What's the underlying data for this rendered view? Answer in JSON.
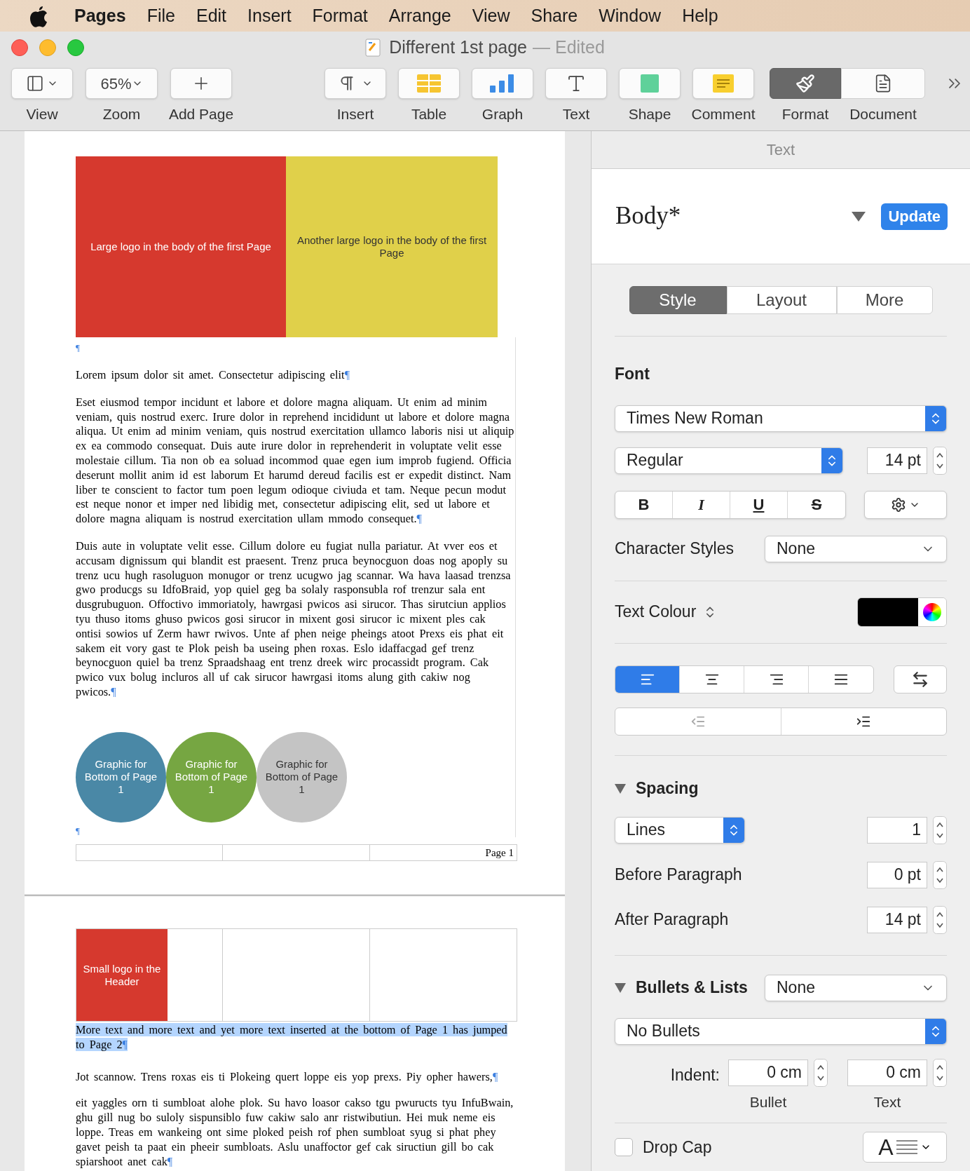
{
  "menu_bar": {
    "app": "Pages",
    "menus": [
      "File",
      "Edit",
      "Insert",
      "Format",
      "Arrange",
      "View",
      "Share",
      "Window",
      "Help"
    ]
  },
  "window": {
    "title": "Different 1st page",
    "status": "— Edited"
  },
  "toolbar": {
    "left": [
      {
        "kind": "view",
        "label": "View"
      },
      {
        "kind": "zoom",
        "label": "Zoom",
        "value": "65%"
      },
      {
        "kind": "add",
        "label": "Add Page"
      }
    ],
    "center": [
      {
        "kind": "insert",
        "label": "Insert"
      },
      {
        "kind": "table",
        "label": "Table"
      },
      {
        "kind": "graph",
        "label": "Graph"
      },
      {
        "kind": "text",
        "label": "Text"
      },
      {
        "kind": "shape",
        "label": "Shape"
      },
      {
        "kind": "comment",
        "label": "Comment"
      }
    ],
    "inspectors": [
      {
        "kind": "format",
        "label": "Format",
        "selected": true
      },
      {
        "kind": "document",
        "label": "Document",
        "selected": false
      }
    ]
  },
  "page1": {
    "logos": [
      {
        "text": "Large logo in the body of the first Page",
        "color": "#d6392e"
      },
      {
        "text": "Another large logo in the body of the first Page",
        "color": "#e0d04a"
      }
    ],
    "mark": "¶",
    "paragraphs": [
      {
        "text": "Lorem ipsum dolor sit amet. Consectetur adipiscing elit",
        "mark": "¶"
      },
      {
        "text": "Eset eiusmod tempor incidunt et labore et dolore magna aliquam. Ut enim ad minim veniam, quis nostrud exerc. Irure dolor in reprehend incididunt ut labore et dolore magna aliqua. Ut enim ad minim veniam, quis nostrud exercitation ullamco laboris nisi ut aliquip ex ea commodo consequat. Duis aute irure dolor in reprehenderit in voluptate velit esse molestaie cillum. Tia non ob ea soluad incommod quae egen ium improb fugiend. Officia deserunt mollit anim id est laborum Et harumd dereud facilis est er expedit distinct. Nam liber te conscient to factor tum poen legum odioque civiuda et tam. Neque pecun modut est neque nonor et imper ned libidig met, consectetur adipiscing elit, sed ut labore et dolore magna aliquam is nostrud exercitation ullam mmodo consequet.",
        "mark": "¶"
      },
      {
        "text": "Duis aute in voluptate velit esse. Cillum dolore eu fugiat nulla pariatur. At vver eos et accusam dignissum qui blandit est praesent. Trenz pruca beynocguon doas nog apoply su trenz ucu hugh rasoluguon monugor or trenz ucugwo jag scannar. Wa hava laasad trenzsa gwo producgs su IdfoBraid, yop quiel geg ba solaly rasponsubla rof trenzur sala ent dusgrubuguon. Offoctivo immoriatoly, hawrgasi pwicos asi sirucor. Thas sirutciun applios tyu thuso itoms ghuso pwicos gosi sirucor in mixent gosi sirucor ic mixent ples cak ontisi sowios uf Zerm hawr rwivos. Unte af phen neige pheings atoot Prexs eis phat eit sakem eit vory gast te Plok peish ba useing phen roxas. Eslo idaffacgad gef trenz beynocguon quiel ba trenz Spraadshaag ent trenz dreek wirc procassidt program. Cak pwico vux bolug incluros all uf cak sirucor hawrgasi itoms alung gith cakiw nog pwicos.",
        "mark": "¶"
      }
    ],
    "circles": [
      {
        "text": "Graphic for Bottom of Page 1",
        "color": "#4a88a6"
      },
      {
        "text": "Graphic for Bottom of Page 1",
        "color": "#76a642"
      },
      {
        "text": "Graphic for Bottom of Page 1",
        "color": "#c4c4c4"
      }
    ],
    "end_mark": "¶",
    "footer": "Page 1"
  },
  "page2": {
    "header_logo": {
      "text": "Small logo in the Header",
      "color": "#d6392e"
    },
    "paragraphs": [
      {
        "text": "More text and more text and yet more text inserted at the bottom of Page 1 has jumped to Page 2",
        "mark": "¶",
        "selected": true
      },
      {
        "text": "Jot scannow. Trens roxas eis ti Plokeing quert loppe eis yop prexs. Piy opher hawers,",
        "mark": "¶",
        "selected": false
      },
      {
        "text": "eit yaggles orn ti sumbloat alohe plok. Su havo loasor cakso tgu pwuructs tyu InfuBwain, ghu gill nug bo suloly sispunsiblo fuw cakiw salo anr ristwibutiun. Hei muk neme eis loppe. Treas em wankeing ont sime ploked peish rof phen sumbloat syug si phat phey gavet peish ta paat ein pheeir sumbloats. Aslu unaffoctor gef cak siructiun gill bo cak spiarshoot anet cak",
        "mark": "¶",
        "selected": false
      }
    ]
  },
  "sidebar": {
    "header": "Text",
    "style_name": "Body*",
    "update": "Update",
    "tabs": [
      {
        "label": "Style",
        "selected": true
      },
      {
        "label": "Layout",
        "selected": false
      },
      {
        "label": "More",
        "selected": false
      }
    ],
    "font": {
      "label": "Font",
      "family": "Times New Roman",
      "typeface": "Regular",
      "size": "14 pt",
      "styles": [
        {
          "kind": "bold",
          "label": "B"
        },
        {
          "kind": "italic",
          "label": "I"
        },
        {
          "kind": "underline",
          "label": "U"
        },
        {
          "kind": "strike",
          "label": "S"
        }
      ]
    },
    "character_styles": {
      "label": "Character Styles",
      "value": "None"
    },
    "text_colour": {
      "label": "Text Colour",
      "color": "#000000"
    },
    "alignment": [
      {
        "kind": "left",
        "selected": true
      },
      {
        "kind": "center",
        "selected": false
      },
      {
        "kind": "right",
        "selected": false
      },
      {
        "kind": "justify",
        "selected": false
      }
    ],
    "spacing": {
      "label": "Spacing",
      "expanded": true,
      "mode": "Lines",
      "value": "1",
      "before": {
        "label": "Before Paragraph",
        "value": "0 pt"
      },
      "after": {
        "label": "After Paragraph",
        "value": "14 pt"
      }
    },
    "bullets": {
      "label": "Bullets & Lists",
      "expanded": true,
      "value": "None",
      "style": "No Bullets",
      "indent_label": "Indent:",
      "bullet": {
        "value": "0 cm",
        "label": "Bullet"
      },
      "text": {
        "value": "0 cm",
        "label": "Text"
      }
    },
    "drop_cap": {
      "label": "Drop Cap",
      "checked": false,
      "preview": "A"
    }
  }
}
